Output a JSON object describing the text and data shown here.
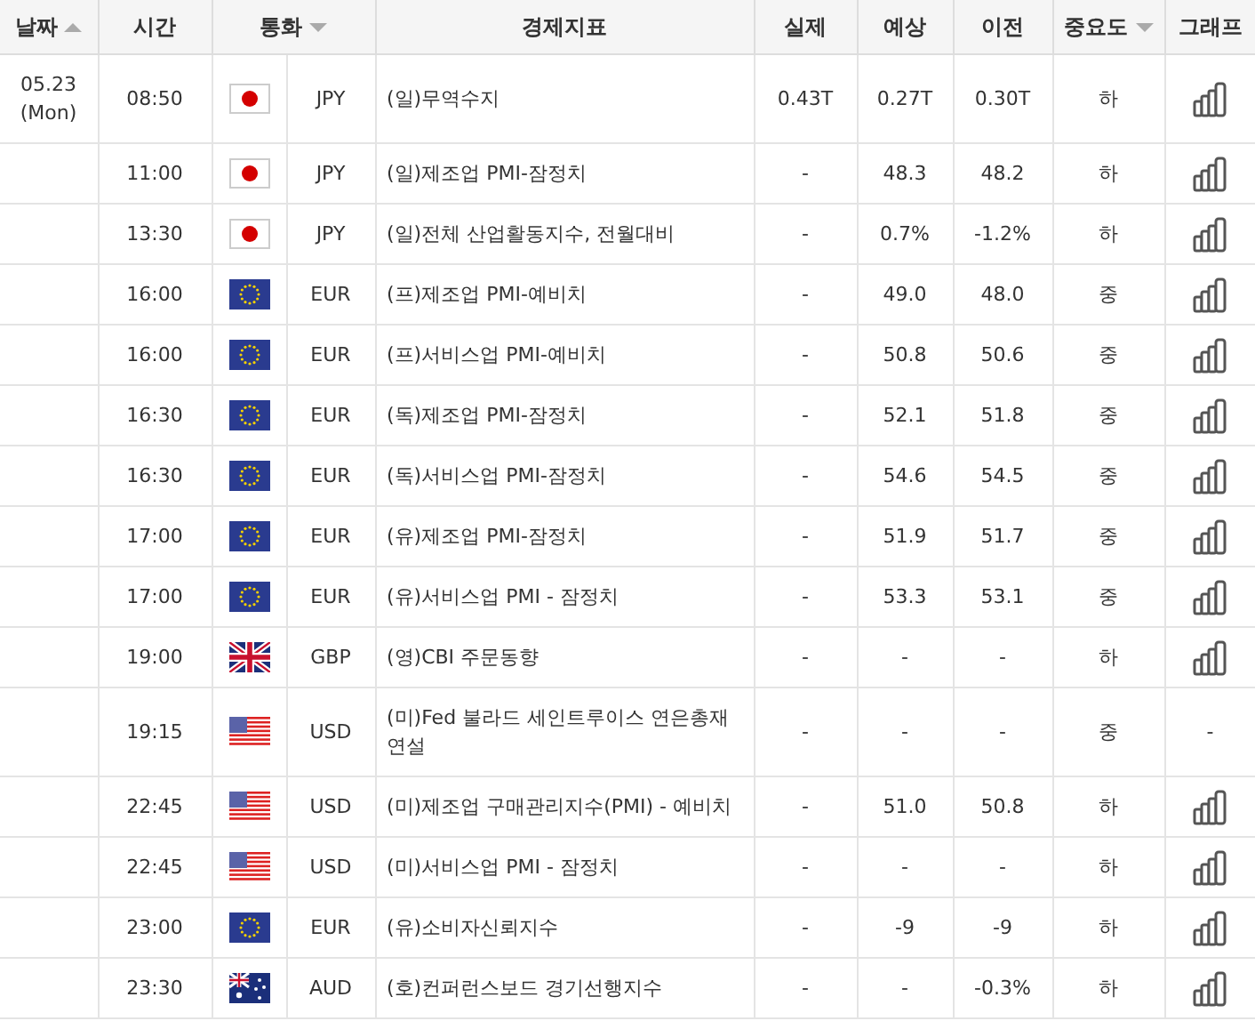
{
  "columns": [
    {
      "label": "날짜",
      "sort": {
        "kind": "asc"
      }
    },
    {
      "label": "시간"
    },
    {
      "label": "통화",
      "sort": {
        "kind": "desc"
      }
    },
    {
      "label": "경제지표"
    },
    {
      "label": "실제"
    },
    {
      "label": "예상"
    },
    {
      "label": "이전"
    },
    {
      "label": "중요도",
      "sort": {
        "kind": "desc"
      }
    },
    {
      "label": "그래프"
    }
  ],
  "rows": [
    {
      "date": "05.23",
      "weekday": "(Mon)",
      "time": "08:50",
      "flag": {
        "kind": "jp"
      },
      "currency": "JPY",
      "indicator": "(일)무역수지",
      "actual": "0.43T",
      "forecast": "0.27T",
      "previous": "0.30T",
      "importance": "하",
      "graph": {
        "kind": "chart"
      }
    },
    {
      "time": "11:00",
      "flag": {
        "kind": "jp"
      },
      "currency": "JPY",
      "indicator": "(일)제조업 PMI-잠정치",
      "actual": "-",
      "forecast": "48.3",
      "previous": "48.2",
      "importance": "하",
      "graph": {
        "kind": "chart"
      }
    },
    {
      "time": "13:30",
      "flag": {
        "kind": "jp"
      },
      "currency": "JPY",
      "indicator": "(일)전체 산업활동지수, 전월대비",
      "actual": "-",
      "forecast": "0.7%",
      "previous": "-1.2%",
      "importance": "하",
      "graph": {
        "kind": "chart"
      }
    },
    {
      "time": "16:00",
      "flag": {
        "kind": "eu"
      },
      "currency": "EUR",
      "indicator": "(프)제조업 PMI-예비치",
      "actual": "-",
      "forecast": "49.0",
      "previous": "48.0",
      "importance": "중",
      "graph": {
        "kind": "chart"
      }
    },
    {
      "time": "16:00",
      "flag": {
        "kind": "eu"
      },
      "currency": "EUR",
      "indicator": "(프)서비스업 PMI-예비치",
      "actual": "-",
      "forecast": "50.8",
      "previous": "50.6",
      "importance": "중",
      "graph": {
        "kind": "chart"
      }
    },
    {
      "time": "16:30",
      "flag": {
        "kind": "eu"
      },
      "currency": "EUR",
      "indicator": "(독)제조업 PMI-잠정치",
      "actual": "-",
      "forecast": "52.1",
      "previous": "51.8",
      "importance": "중",
      "graph": {
        "kind": "chart"
      }
    },
    {
      "time": "16:30",
      "flag": {
        "kind": "eu"
      },
      "currency": "EUR",
      "indicator": "(독)서비스업 PMI-잠정치",
      "actual": "-",
      "forecast": "54.6",
      "previous": "54.5",
      "importance": "중",
      "graph": {
        "kind": "chart"
      }
    },
    {
      "time": "17:00",
      "flag": {
        "kind": "eu"
      },
      "currency": "EUR",
      "indicator": "(유)제조업 PMI-잠정치",
      "actual": "-",
      "forecast": "51.9",
      "previous": "51.7",
      "importance": "중",
      "graph": {
        "kind": "chart"
      }
    },
    {
      "time": "17:00",
      "flag": {
        "kind": "eu"
      },
      "currency": "EUR",
      "indicator": "(유)서비스업 PMI - 잠정치",
      "actual": "-",
      "forecast": "53.3",
      "previous": "53.1",
      "importance": "중",
      "graph": {
        "kind": "chart"
      }
    },
    {
      "time": "19:00",
      "flag": {
        "kind": "gb"
      },
      "currency": "GBP",
      "indicator": "(영)CBI 주문동향",
      "actual": "-",
      "forecast": "-",
      "previous": "-",
      "importance": "하",
      "graph": {
        "kind": "chart"
      }
    },
    {
      "time": "19:15",
      "flag": {
        "kind": "us"
      },
      "currency": "USD",
      "indicator": "(미)Fed 불라드 세인트루이스 연은총재 연설",
      "actual": "-",
      "forecast": "-",
      "previous": "-",
      "importance": "중",
      "graph": {
        "kind": "none",
        "text": "-"
      }
    },
    {
      "time": "22:45",
      "flag": {
        "kind": "us"
      },
      "currency": "USD",
      "indicator": "(미)제조업 구매관리지수(PMI) - 예비치",
      "actual": "-",
      "forecast": "51.0",
      "previous": "50.8",
      "importance": "하",
      "graph": {
        "kind": "chart"
      }
    },
    {
      "time": "22:45",
      "flag": {
        "kind": "us"
      },
      "currency": "USD",
      "indicator": "(미)서비스업 PMI - 잠정치",
      "actual": "-",
      "forecast": "-",
      "previous": "-",
      "importance": "하",
      "graph": {
        "kind": "chart"
      }
    },
    {
      "time": "23:00",
      "flag": {
        "kind": "eu"
      },
      "currency": "EUR",
      "indicator": "(유)소비자신뢰지수",
      "actual": "-",
      "forecast": "-9",
      "previous": "-9",
      "importance": "하",
      "graph": {
        "kind": "chart"
      }
    },
    {
      "time": "23:30",
      "flag": {
        "kind": "au"
      },
      "currency": "AUD",
      "indicator": "(호)컨퍼런스보드 경기선행지수",
      "actual": "-",
      "forecast": "-",
      "previous": "-0.3%",
      "importance": "하",
      "graph": {
        "kind": "chart"
      }
    }
  ]
}
